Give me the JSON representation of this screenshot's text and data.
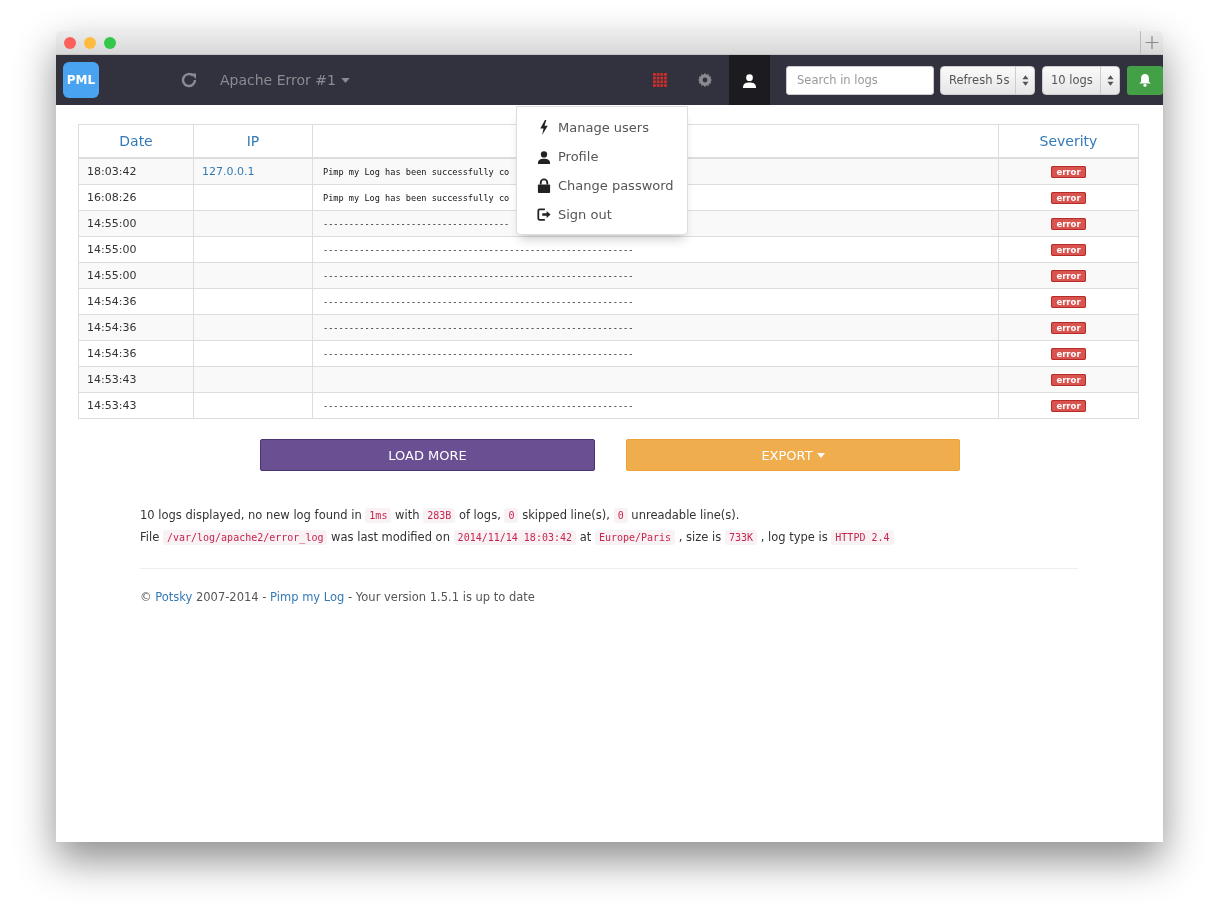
{
  "navbar": {
    "logo": "PML",
    "log_selector": "Apache Error #1",
    "search": {
      "placeholder": "Search in logs"
    },
    "refresh_select": "Refresh 5s",
    "count_select": "10 logs",
    "notifications_on": true,
    "user_menu": {
      "expanded": true,
      "items": [
        {
          "label": "Manage users",
          "kind": "bolt"
        },
        {
          "label": "Profile",
          "kind": "user"
        },
        {
          "label": "Change password",
          "kind": "lock"
        },
        {
          "label": "Sign out",
          "kind": "signout"
        }
      ]
    }
  },
  "table": {
    "columns": {
      "date": "Date",
      "ip": "IP",
      "severity": "Severity"
    },
    "rows": [
      {
        "date": "18:03:42",
        "ip": "127.0.0.1",
        "message": "Pimp my Log has been successfully co",
        "severity": "error"
      },
      {
        "date": "16:08:26",
        "message": "Pimp my Log has been successfully co",
        "severity": "error"
      },
      {
        "date": "14:55:00",
        "message": "------------------------------------",
        "severity": "error"
      },
      {
        "date": "14:55:00",
        "message": "------------------------------------------------------------",
        "severity": "error"
      },
      {
        "date": "14:55:00",
        "message": "------------------------------------------------------------",
        "severity": "error"
      },
      {
        "date": "14:54:36",
        "message": "------------------------------------------------------------",
        "severity": "error"
      },
      {
        "date": "14:54:36",
        "message": "------------------------------------------------------------",
        "severity": "error"
      },
      {
        "date": "14:54:36",
        "message": "------------------------------------------------------------",
        "severity": "error"
      },
      {
        "date": "14:53:43",
        "severity": "error"
      },
      {
        "date": "14:53:43",
        "message": "------------------------------------------------------------",
        "severity": "error"
      }
    ]
  },
  "actions": {
    "load_more": "LOAD MORE",
    "export": "EXPORT"
  },
  "stats": [
    [
      {
        "kind": "text",
        "text": "10 logs displayed, no new log found in"
      },
      {
        "kind": "code",
        "text": "1ms"
      },
      {
        "kind": "text",
        "text": "with"
      },
      {
        "kind": "code",
        "text": "283B"
      },
      {
        "kind": "text",
        "text": "of logs,"
      },
      {
        "kind": "code",
        "text": "0"
      },
      {
        "kind": "text",
        "text": "skipped line(s),"
      },
      {
        "kind": "code",
        "text": "0"
      },
      {
        "kind": "text",
        "text": "unreadable line(s)."
      }
    ],
    [
      {
        "kind": "text",
        "text": "File"
      },
      {
        "kind": "code",
        "text": "/var/log/apache2/error_log"
      },
      {
        "kind": "text",
        "text": "was last modified on"
      },
      {
        "kind": "code",
        "text": "2014/11/14 18:03:42"
      },
      {
        "kind": "text",
        "text": "at"
      },
      {
        "kind": "code",
        "text": "Europe/Paris"
      },
      {
        "kind": "text",
        "text": ", size is"
      },
      {
        "kind": "code",
        "text": "733K"
      },
      {
        "kind": "text",
        "text": ", log type is"
      },
      {
        "kind": "code",
        "text": "HTTPD 2.4"
      }
    ]
  ],
  "footer": [
    {
      "kind": "text",
      "text": "©"
    },
    {
      "kind": "link",
      "text": "Potsky"
    },
    {
      "kind": "text",
      "text": "2007-2014 -"
    },
    {
      "kind": "link",
      "text": "Pimp my Log"
    },
    {
      "kind": "text",
      "text": "- Your version 1.5.1 is up to date"
    }
  ]
}
